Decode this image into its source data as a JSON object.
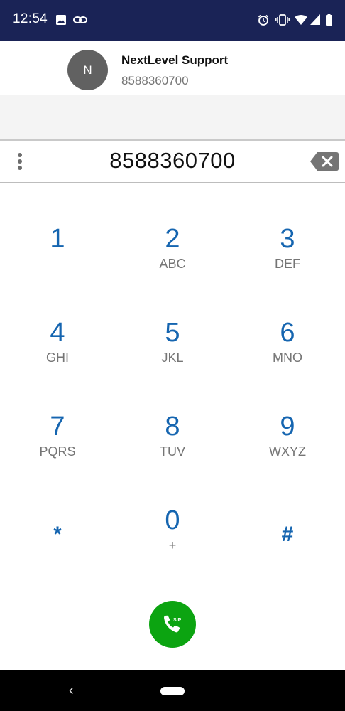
{
  "status_bar": {
    "time": "12:54",
    "left_icons": [
      "image-icon",
      "link-icon"
    ],
    "right_icons": [
      "alarm-icon",
      "vibrate-icon",
      "wifi-icon",
      "signal-icon",
      "battery-icon"
    ],
    "background_color": "#1a2356"
  },
  "contact": {
    "avatar_initial": "N",
    "name": "NextLevel Support",
    "number": "8588360700"
  },
  "dialer": {
    "dialed_number": "8588360700",
    "menu_icon": "more-vert-icon",
    "backspace_icon": "backspace-icon"
  },
  "keypad": {
    "digit_color": "#1565b0",
    "keys": [
      {
        "digit": "1",
        "letters": ""
      },
      {
        "digit": "2",
        "letters": "ABC"
      },
      {
        "digit": "3",
        "letters": "DEF"
      },
      {
        "digit": "4",
        "letters": "GHI"
      },
      {
        "digit": "5",
        "letters": "JKL"
      },
      {
        "digit": "6",
        "letters": "MNO"
      },
      {
        "digit": "7",
        "letters": "PQRS"
      },
      {
        "digit": "8",
        "letters": "TUV"
      },
      {
        "digit": "9",
        "letters": "WXYZ"
      },
      {
        "digit": "*",
        "letters": ""
      },
      {
        "digit": "0",
        "letters": "+"
      },
      {
        "digit": "#",
        "letters": ""
      }
    ]
  },
  "call_button": {
    "badge": "SIP",
    "icon": "phone-icon",
    "color": "#0ca411"
  },
  "nav_bar": {
    "back_glyph": "‹",
    "back_icon": "back-icon",
    "home_icon": "home-pill-icon"
  }
}
